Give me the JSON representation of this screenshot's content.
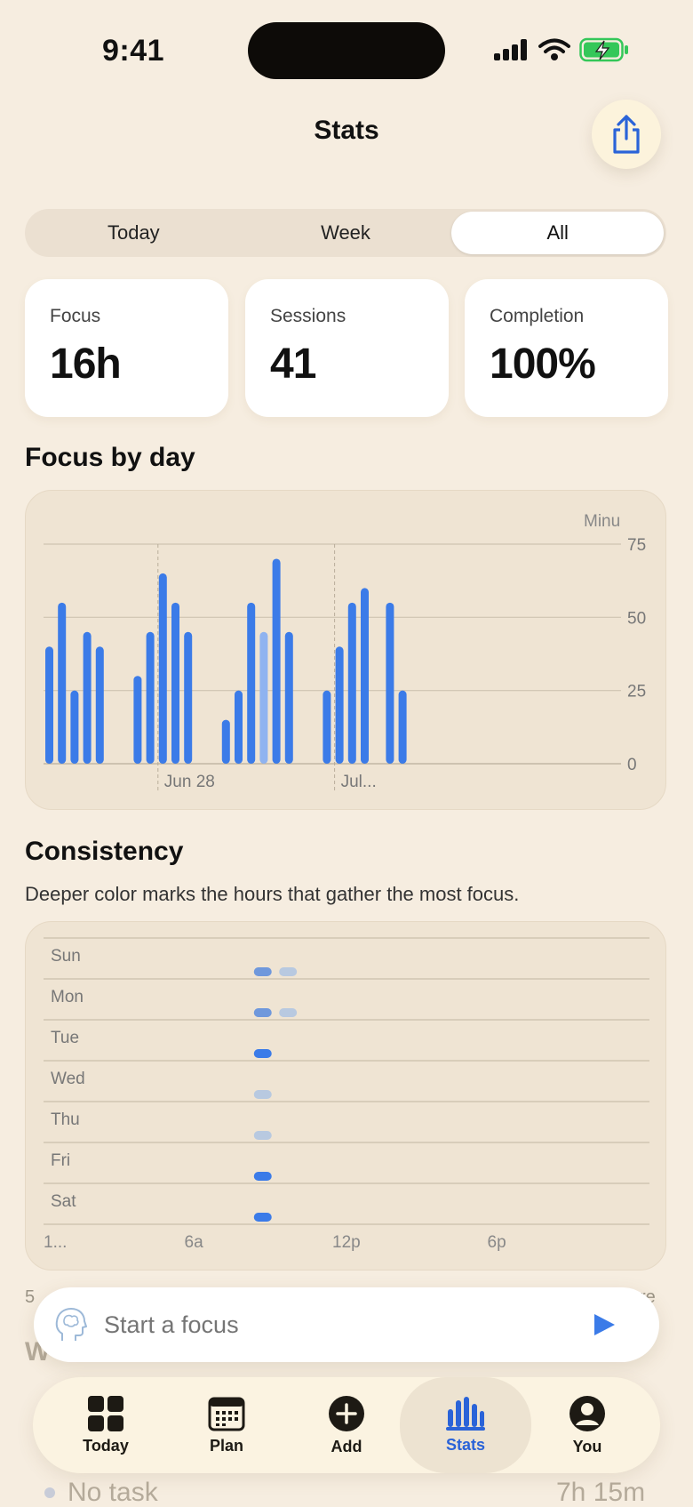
{
  "status": {
    "time": "9:41"
  },
  "header": {
    "title": "Stats"
  },
  "range_tabs": [
    {
      "label": "Today",
      "active": false
    },
    {
      "label": "Week",
      "active": false
    },
    {
      "label": "All",
      "active": true
    }
  ],
  "metrics": [
    {
      "label": "Focus",
      "value": "16h"
    },
    {
      "label": "Sessions",
      "value": "41"
    },
    {
      "label": "Completion",
      "value": "100%"
    }
  ],
  "focus_by_day": {
    "title": "Focus by day"
  },
  "consistency": {
    "title": "Consistency",
    "subtitle": "Deeper color marks the hours that gather the most focus."
  },
  "chart_data": [
    {
      "type": "bar",
      "title": "Focus by day",
      "ylabel": "Minu",
      "ylim": [
        0,
        75
      ],
      "yticks": [
        0,
        25,
        50,
        75
      ],
      "x_labels": [
        {
          "label": "Jun 28",
          "index": 9
        },
        {
          "label": "Jul...",
          "index": 23
        }
      ],
      "highlight_index": 17,
      "values": [
        40,
        55,
        25,
        45,
        40,
        null,
        null,
        30,
        45,
        65,
        55,
        45,
        null,
        null,
        15,
        25,
        55,
        45,
        70,
        45,
        null,
        null,
        25,
        40,
        55,
        60,
        null,
        55,
        25
      ],
      "grid": true
    },
    {
      "type": "heatmap",
      "title": "Consistency",
      "rows": [
        "Sun",
        "Mon",
        "Tue",
        "Wed",
        "Thu",
        "Fri",
        "Sat"
      ],
      "x_tick_labels": [
        "1...",
        "6a",
        "12p",
        "6p"
      ],
      "cells": [
        {
          "row": 0,
          "hour": 9,
          "level": "medium"
        },
        {
          "row": 0,
          "hour": 10,
          "level": "light"
        },
        {
          "row": 1,
          "hour": 9,
          "level": "medium"
        },
        {
          "row": 1,
          "hour": 10,
          "level": "light"
        },
        {
          "row": 2,
          "hour": 9,
          "level": "high"
        },
        {
          "row": 3,
          "hour": 9,
          "level": "light"
        },
        {
          "row": 4,
          "hour": 9,
          "level": "light"
        },
        {
          "row": 5,
          "hour": 9,
          "level": "high"
        },
        {
          "row": 6,
          "hour": 9,
          "level": "high"
        }
      ]
    }
  ],
  "peek": {
    "left_fragment": "5",
    "right_fragment": "re",
    "section_fragment": "W",
    "bottom_task": "No task",
    "bottom_time": "7h 15m"
  },
  "focus_input": {
    "placeholder": "Start a focus"
  },
  "tabbar": [
    {
      "label": "Today",
      "icon": "grid-icon",
      "active": false
    },
    {
      "label": "Plan",
      "icon": "calendar-icon",
      "active": false
    },
    {
      "label": "Add",
      "icon": "plus-circle-icon",
      "active": false
    },
    {
      "label": "Stats",
      "icon": "bar-chart-icon",
      "active": true
    },
    {
      "label": "You",
      "icon": "person-circle-icon",
      "active": false
    }
  ],
  "colors": {
    "accent": "#3b7be8",
    "accent_light": "#8fb3f0",
    "heat_light": "#b8c9e0",
    "heat_medium": "#6f98dc",
    "heat_high": "#3b7be8",
    "battery": "#34c759"
  }
}
